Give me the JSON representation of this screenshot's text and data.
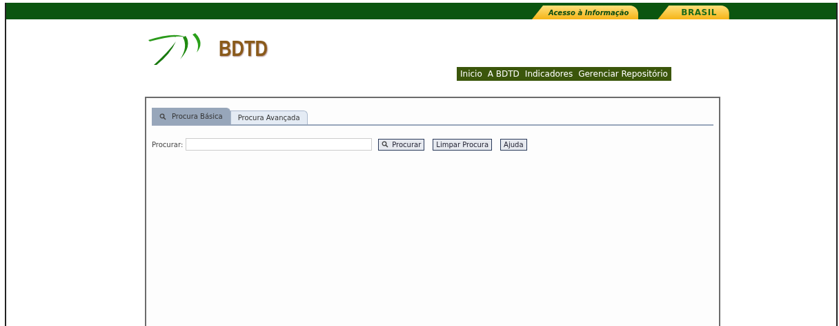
{
  "top_bar": {
    "links": [
      "Acesso à Informação",
      "BRASIL"
    ]
  },
  "logo": {
    "text": "BDTD"
  },
  "nav": {
    "items": [
      "Inicio",
      "A BDTD",
      "Indicadores",
      "Gerenciar Repositório"
    ]
  },
  "tabs": [
    {
      "label": "Procura Básica",
      "selected": true,
      "icon": true
    },
    {
      "label": "Procura Avançada",
      "selected": false,
      "icon": false
    }
  ],
  "search": {
    "label": "Procurar:",
    "buttons": [
      {
        "label": "Procurar",
        "icon": true
      },
      {
        "label": "Limpar Procura",
        "icon": false
      },
      {
        "label": "Ajuda",
        "icon": false
      }
    ]
  }
}
